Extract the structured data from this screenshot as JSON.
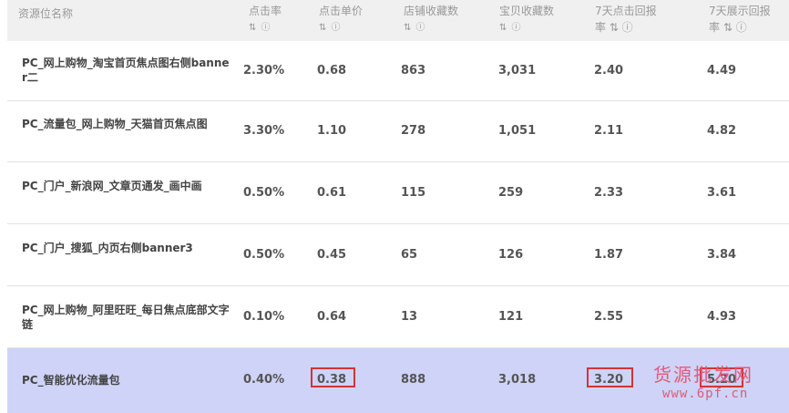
{
  "table": {
    "headers": [
      {
        "line1": "资源位名称",
        "line2": ""
      },
      {
        "line1": "点击率",
        "line2": "⇅ ⓘ"
      },
      {
        "line1": "点击单价",
        "line2": "⇅ ⓘ"
      },
      {
        "line1": "店铺收藏数",
        "line2": "⇅ ⓘ"
      },
      {
        "line1": "宝贝收藏数",
        "line2": "⇅ ⓘ"
      },
      {
        "line1": "7天点击回报",
        "line2": "率 ⇅ ⓘ"
      },
      {
        "line1": "7天展示回报",
        "line2": "率 ⇅ ⓘ"
      }
    ],
    "rows": [
      {
        "name": "PC_网上购物_淘宝首页焦点图右侧banner二",
        "ctr": "2.30%",
        "cpc": "0.68",
        "shop_fav": "863",
        "item_fav": "3,031",
        "roi_click": "2.40",
        "roi_show": "4.49"
      },
      {
        "name": "PC_流量包_网上购物_天猫首页焦点图",
        "ctr": "3.30%",
        "cpc": "1.10",
        "shop_fav": "278",
        "item_fav": "1,051",
        "roi_click": "2.11",
        "roi_show": "4.82"
      },
      {
        "name": "PC_门户_新浪网_文章页通发_画中画",
        "ctr": "0.50%",
        "cpc": "0.61",
        "shop_fav": "115",
        "item_fav": "259",
        "roi_click": "2.33",
        "roi_show": "3.61"
      },
      {
        "name": "PC_门户_搜狐_内页右侧banner3",
        "ctr": "0.50%",
        "cpc": "0.45",
        "shop_fav": "65",
        "item_fav": "126",
        "roi_click": "1.87",
        "roi_show": "3.84"
      },
      {
        "name": "PC_网上购物_阿里旺旺_每日焦点底部文字链",
        "ctr": "0.10%",
        "cpc": "0.64",
        "shop_fav": "13",
        "item_fav": "121",
        "roi_click": "2.55",
        "roi_show": "4.93"
      },
      {
        "name": "PC_智能优化流量包",
        "ctr": "0.40%",
        "cpc": "0.38",
        "shop_fav": "888",
        "item_fav": "3,018",
        "roi_click": "3.20",
        "roi_show": "5.20"
      }
    ]
  },
  "watermark": {
    "line1": "货源批发网",
    "line2": "www.6pf.cn"
  }
}
